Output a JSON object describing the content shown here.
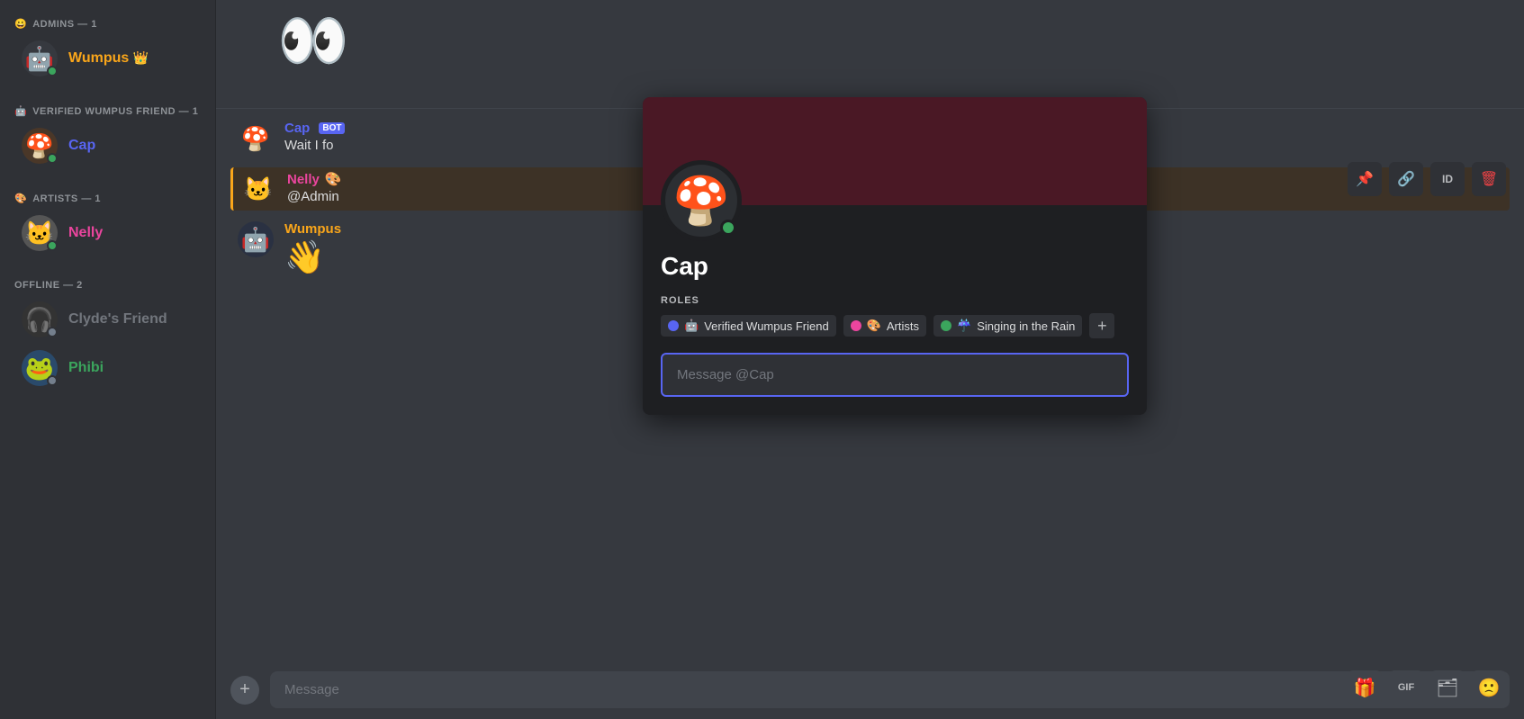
{
  "sidebar": {
    "sections": [
      {
        "id": "admins",
        "header": "ADMINS — 1",
        "header_emoji": "😀",
        "members": [
          {
            "id": "wumpus",
            "name": "Wumpus",
            "name_class": "admin",
            "status": "online",
            "emoji_avatar": "🤖",
            "crown": "👑"
          }
        ]
      },
      {
        "id": "verified",
        "header": "VERIFIED WUMPUS FRIEND — 1",
        "header_emoji": "🤖",
        "members": [
          {
            "id": "cap",
            "name": "Cap",
            "name_class": "verified",
            "status": "online",
            "emoji_avatar": "🍄"
          }
        ]
      },
      {
        "id": "artists",
        "header": "ARTISTS — 1",
        "header_emoji": "🎨",
        "members": [
          {
            "id": "nelly",
            "name": "Nelly",
            "name_class": "artist",
            "status": "online",
            "emoji_avatar": "🐱"
          }
        ]
      },
      {
        "id": "offline",
        "header": "OFFLINE — 2",
        "header_emoji": null,
        "members": [
          {
            "id": "clyde",
            "name": "Clyde's Friend",
            "name_class": "offline",
            "status": "offline",
            "emoji_avatar": "🎧"
          },
          {
            "id": "phibi",
            "name": "Phibi",
            "name_class": "green",
            "status": "offline",
            "emoji_avatar": "🐸"
          }
        ]
      }
    ]
  },
  "chat": {
    "messages": [
      {
        "id": "msg1",
        "author": "Cap",
        "author_class": "blue",
        "avatar_emoji": "🍄",
        "text": "Wait I fo",
        "tag": "BOT",
        "highlighted": false
      },
      {
        "id": "msg2",
        "author": "Nelly",
        "author_class": "pink",
        "avatar_emoji": "🐱",
        "text": "@Admin",
        "tag": "🎨",
        "highlighted": true
      },
      {
        "id": "msg3",
        "author": "Wumpus",
        "author_class": "yellow",
        "avatar_emoji": "🤖",
        "text": "👋",
        "tag": null,
        "highlighted": false
      }
    ],
    "input_placeholder": "Message"
  },
  "profile_popup": {
    "name": "Cap",
    "roles_label": "ROLES",
    "roles": [
      {
        "id": "verified-wumpus-friend",
        "dot_class": "blue",
        "icon": "🤖",
        "label": "Verified Wumpus Friend"
      },
      {
        "id": "artists",
        "dot_class": "pink",
        "icon": "🎨",
        "label": "Artists"
      },
      {
        "id": "singing-in-the-rain",
        "dot_class": "green",
        "icon": "☔",
        "label": "Singing in the Rain"
      }
    ],
    "message_placeholder": "Message @Cap",
    "add_role_label": "+"
  },
  "popup_actions": {
    "pin_icon": "📌",
    "link_icon": "🔗",
    "id_label": "ID",
    "delete_icon": "🗑"
  },
  "bottom_actions": {
    "gift_icon": "🎁",
    "gif_label": "GIF",
    "sticker_icon": "🗂",
    "emoji_icon": "🙁"
  },
  "eyes": "👀"
}
